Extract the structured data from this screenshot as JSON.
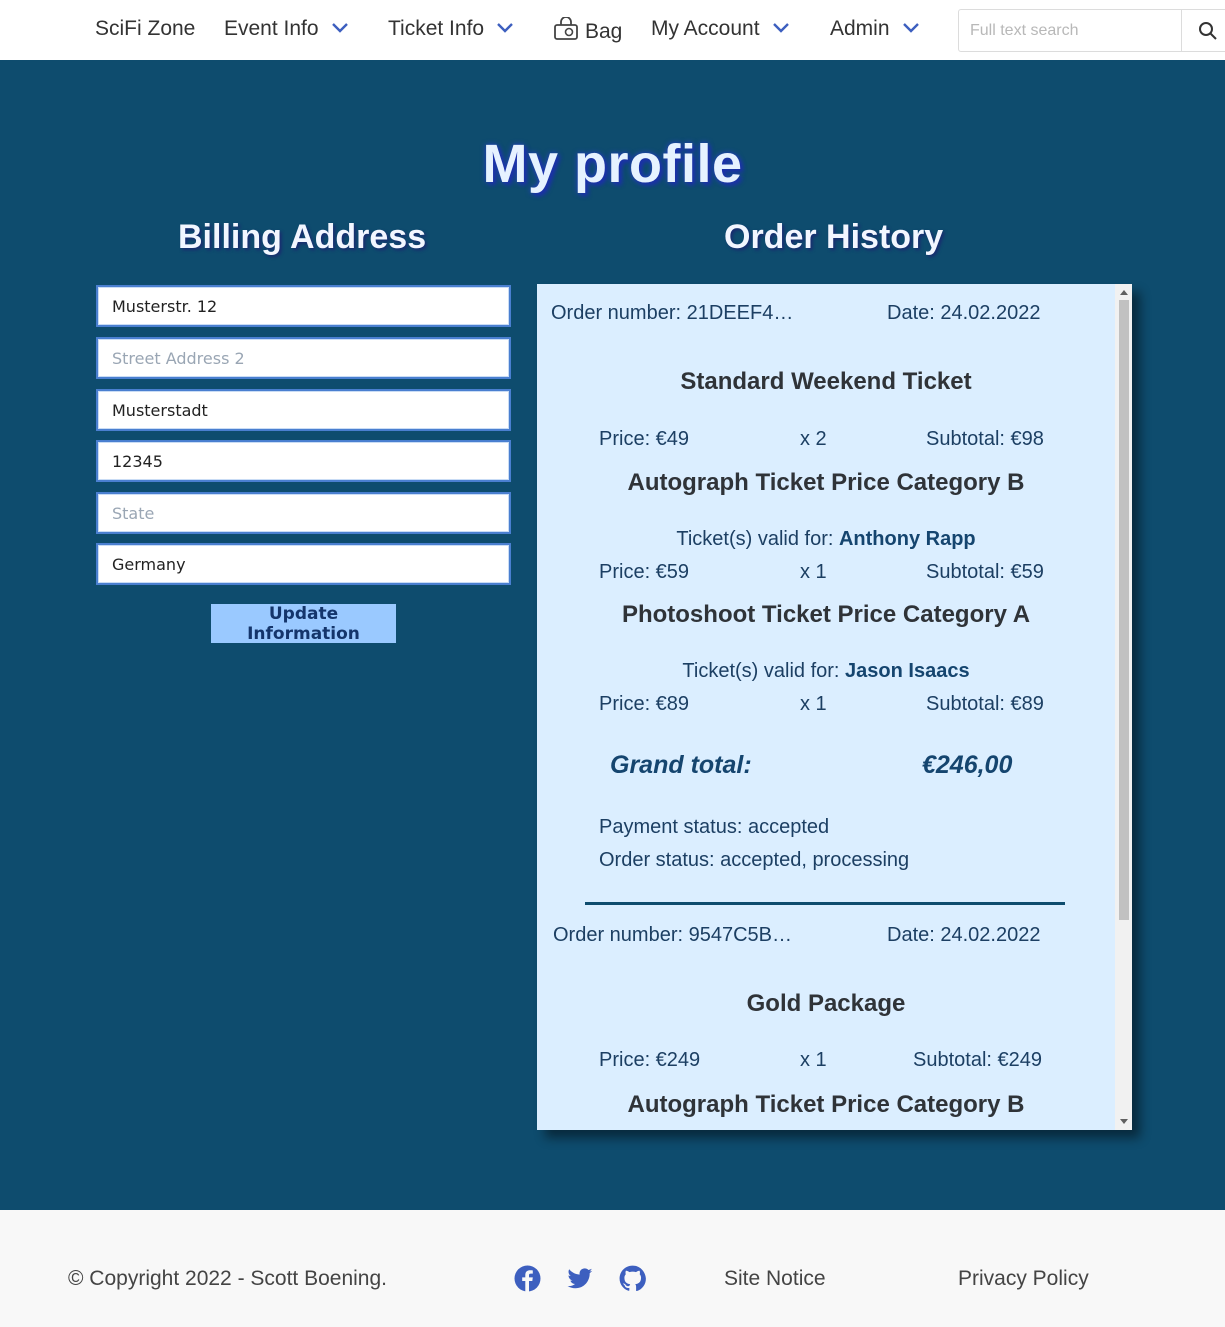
{
  "nav": {
    "brand": "SciFi Zone",
    "event_info": "Event Info",
    "ticket_info": "Ticket Info",
    "bag": "Bag",
    "my_account": "My Account",
    "admin": "Admin",
    "search_placeholder": "Full text search"
  },
  "page": {
    "title": "My profile"
  },
  "billing": {
    "heading": "Billing Address",
    "street1": "Musterstr. 12",
    "street2_placeholder": "Street Address 2",
    "city": "Musterstadt",
    "postcode": "12345",
    "state_placeholder": "State",
    "country": "Germany",
    "update_button": "Update Information"
  },
  "orders": {
    "heading": "Order History",
    "list": [
      {
        "number_label": "Order number: 21DEEF4…",
        "date_label": "Date: 24.02.2022",
        "items": [
          {
            "name": "Standard Weekend Ticket",
            "price": "Price: €49",
            "qty": "x 2",
            "subtotal": "Subtotal: €98"
          },
          {
            "name": "Autograph Ticket Price Category B",
            "valid_prefix": "Ticket(s) valid for: ",
            "valid_for": "Anthony Rapp",
            "price": "Price: €59",
            "qty": "x 1",
            "subtotal": "Subtotal: €59"
          },
          {
            "name": "Photoshoot Ticket Price Category A",
            "valid_prefix": "Ticket(s) valid for: ",
            "valid_for": "Jason Isaacs",
            "price": "Price: €89",
            "qty": "x 1",
            "subtotal": "Subtotal: €89"
          }
        ],
        "grand_total_label": "Grand total:",
        "grand_total": "€246,00",
        "payment_status": "Payment status: accepted",
        "order_status": "Order status: accepted, processing"
      },
      {
        "number_label": "Order number: 9547C5B…",
        "date_label": "Date: 24.02.2022",
        "items": [
          {
            "name": "Gold Package",
            "price": "Price: €249",
            "qty": "x 1",
            "subtotal": "Subtotal: €249"
          },
          {
            "name": "Autograph Ticket Price Category B"
          }
        ]
      }
    ]
  },
  "footer": {
    "copyright": "© Copyright 2022 - Scott Boening.",
    "site_notice": "Site Notice",
    "privacy_policy": "Privacy Policy"
  },
  "colors": {
    "page_bg": "#0e4c6e",
    "panel_bg": "#dbeeff",
    "button_bg": "#9ac9ff",
    "icon_blue": "#3d5fbf"
  },
  "icons": [
    "chevron-down-icon",
    "shopping-bag-icon",
    "search-icon",
    "facebook-icon",
    "twitter-icon",
    "github-icon"
  ]
}
